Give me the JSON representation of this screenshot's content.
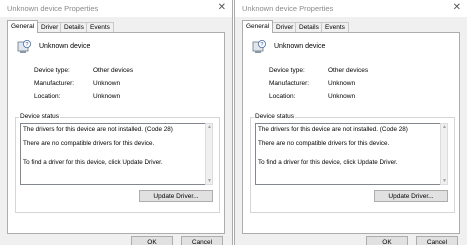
{
  "window": {
    "title": "Unknown device Properties",
    "close_glyph": "✕"
  },
  "tabs": [
    "General",
    "Driver",
    "Details",
    "Events"
  ],
  "device": {
    "name": "Unknown device",
    "icon": "unknown-device-icon"
  },
  "properties": [
    {
      "label": "Device type:",
      "value": "Other devices"
    },
    {
      "label": "Manufacturer:",
      "value": "Unknown"
    },
    {
      "label": "Location:",
      "value": "Unknown"
    }
  ],
  "status": {
    "group_label": "Device status",
    "lines": [
      "The drivers for this device are not installed. (Code 28)",
      "There are no compatible drivers for this device.",
      "To find a driver for this device, click Update Driver."
    ]
  },
  "buttons": {
    "update_driver": "Update Driver...",
    "ok": "OK",
    "cancel": "Cancel"
  }
}
